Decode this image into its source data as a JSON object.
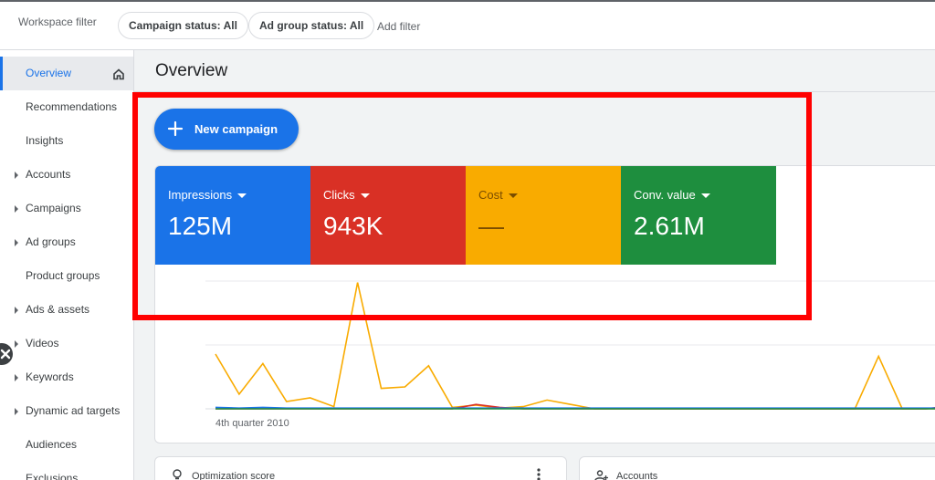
{
  "topbar": {
    "workspace_label": "Workspace filter",
    "chips": [
      "Campaign status: All",
      "Ad group status: All"
    ],
    "add_filter": "Add filter"
  },
  "sidebar": {
    "items": [
      {
        "label": "Overview",
        "active": true,
        "expandable": false,
        "icon": "home-icon"
      },
      {
        "label": "Recommendations",
        "expandable": false
      },
      {
        "label": "Insights",
        "expandable": false
      },
      {
        "label": "Accounts",
        "expandable": true
      },
      {
        "label": "Campaigns",
        "expandable": true
      },
      {
        "label": "Ad groups",
        "expandable": true
      },
      {
        "label": "Product groups",
        "expandable": false
      },
      {
        "label": "Ads & assets",
        "expandable": true
      },
      {
        "label": "Videos",
        "expandable": true
      },
      {
        "label": "Keywords",
        "expandable": true
      },
      {
        "label": "Dynamic ad targets",
        "expandable": true
      },
      {
        "label": "Audiences",
        "expandable": false
      },
      {
        "label": "Exclusions",
        "expandable": false
      }
    ]
  },
  "main": {
    "title": "Overview",
    "new_campaign_label": "New campaign",
    "metrics": [
      {
        "label": "Impressions",
        "value": "125M",
        "color": "#1a73e8"
      },
      {
        "label": "Clicks",
        "value": "943K",
        "color": "#d93025"
      },
      {
        "label": "Cost",
        "value": "—",
        "color": "#f9ab00"
      },
      {
        "label": "Conv. value",
        "value": "2.61M",
        "color": "#1e8e3e"
      }
    ],
    "chart": {
      "x_label": "4th quarter 2010",
      "series": [
        {
          "color": "#f9ab00",
          "values": [
            0.75,
            0.2,
            0.62,
            0.1,
            0.15,
            0.03,
            1.73,
            0.28,
            0.3,
            0.59,
            0.02,
            0.05,
            0.01,
            0.03,
            0.12,
            0.06,
            0,
            0,
            0,
            0,
            0,
            0,
            0,
            0,
            0,
            0,
            0,
            0,
            0.72,
            0,
            0,
            0
          ]
        },
        {
          "color": "#d93025",
          "values": [
            0,
            0,
            0,
            0,
            0,
            0,
            0,
            0,
            0,
            0,
            0,
            0.06,
            0.02,
            0,
            0,
            0,
            0,
            0,
            0,
            0,
            0,
            0,
            0,
            0,
            0,
            0,
            0,
            0,
            0,
            0,
            0,
            0.04
          ]
        },
        {
          "color": "#1a73e8",
          "values": [
            0.02,
            0.01,
            0.02,
            0.01,
            0.01,
            0.01,
            0.01,
            0.01,
            0.01,
            0.01,
            0.01,
            0.01,
            0.01,
            0.01,
            0.01,
            0.01,
            0.01,
            0.01,
            0.01,
            0.01,
            0.01,
            0.01,
            0.01,
            0.01,
            0.01,
            0.01,
            0.01,
            0.01,
            0.01,
            0.01,
            0.01,
            0.01
          ]
        },
        {
          "color": "#1e8e3e",
          "values": [
            0,
            0,
            0,
            0,
            0,
            0,
            0,
            0,
            0,
            0,
            0,
            0,
            0,
            0,
            0,
            0,
            0,
            0,
            0,
            0,
            0,
            0,
            0,
            0,
            0,
            0,
            0,
            0,
            0,
            0,
            0,
            0
          ]
        }
      ]
    },
    "cards": {
      "optimization_label": "Optimization score",
      "accounts_label": "Accounts"
    }
  }
}
